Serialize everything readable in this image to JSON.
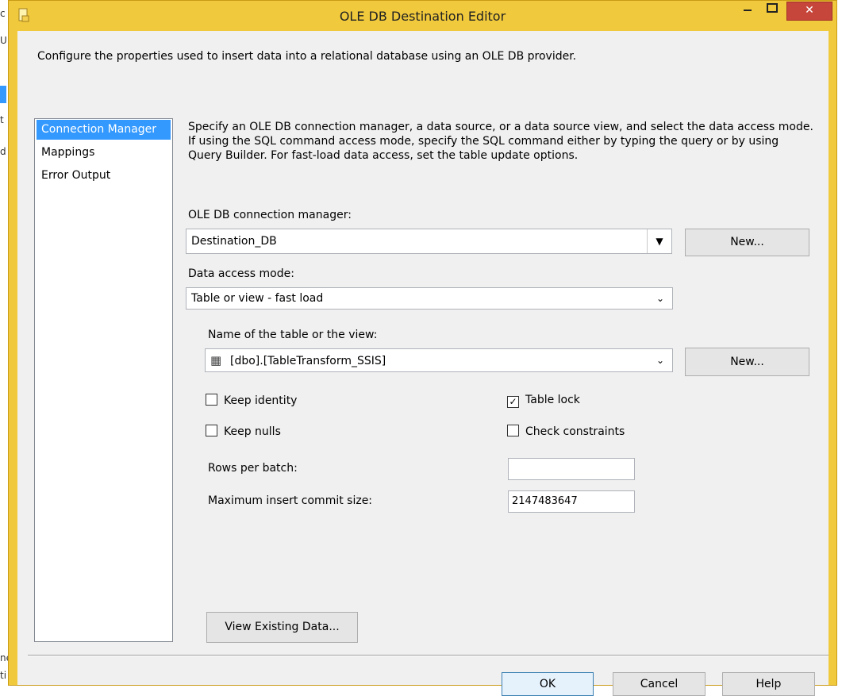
{
  "window": {
    "title": "OLE DB Destination Editor"
  },
  "background": {
    "left_fragments": [
      "c",
      "U",
      "t",
      "d",
      "ne",
      "ti"
    ]
  },
  "intro": "Configure the properties used to insert data into a relational database using an OLE DB provider.",
  "nav": {
    "items": [
      "Connection Manager",
      "Mappings",
      "Error Output"
    ]
  },
  "description": "Specify an OLE DB connection manager, a data source, or a data source view, and select the data access mode. If using the SQL command access mode, specify the SQL command either by typing the query or by using Query Builder. For fast-load data access, set the table update options.",
  "connection": {
    "label": "OLE DB connection manager:",
    "value": "Destination_DB",
    "new_label": "New..."
  },
  "access_mode": {
    "label": "Data access mode:",
    "value": "Table or view - fast load"
  },
  "table": {
    "label": "Name of the table or the view:",
    "value": "[dbo].[TableTransform_SSIS]",
    "new_label": "New..."
  },
  "options": {
    "keep_identity": {
      "label": "Keep identity",
      "checked": false
    },
    "table_lock": {
      "label": "Table lock",
      "checked": true
    },
    "keep_nulls": {
      "label": "Keep nulls",
      "checked": false
    },
    "check_constraints": {
      "label": "Check constraints",
      "checked": false
    }
  },
  "rows_per_batch": {
    "label": "Rows per batch:",
    "value": ""
  },
  "max_commit": {
    "label": "Maximum insert commit size:",
    "value": "2147483647"
  },
  "view_data_label": "View Existing Data...",
  "buttons": {
    "ok": "OK",
    "cancel": "Cancel",
    "help": "Help"
  },
  "colors": {
    "frame": "#f0c93c",
    "selection": "#3399ff",
    "close": "#c7463c"
  }
}
